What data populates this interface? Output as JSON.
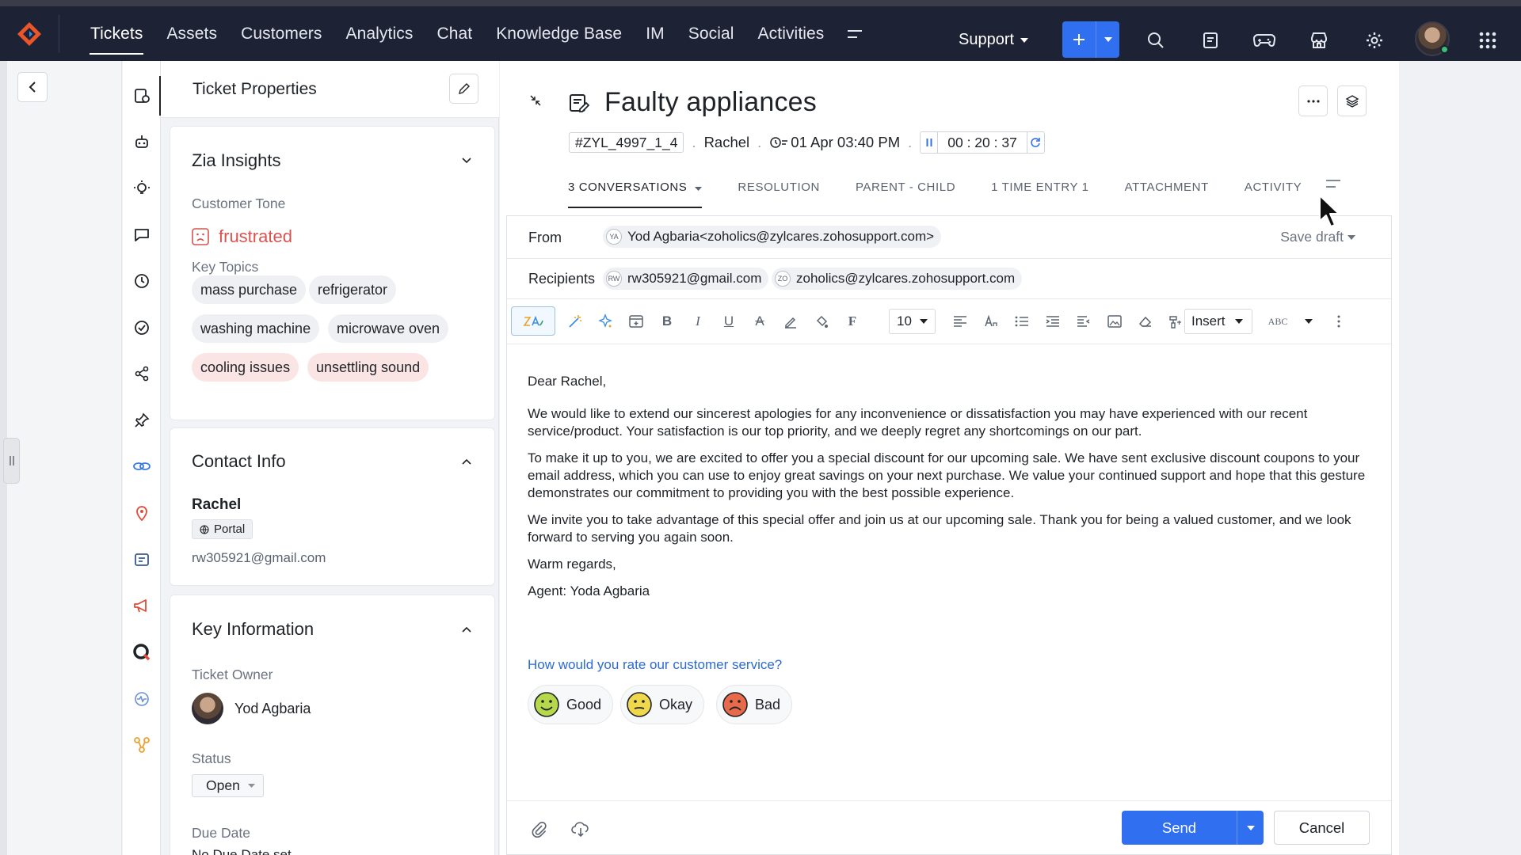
{
  "nav": {
    "tabs": [
      "Tickets",
      "Assets",
      "Customers",
      "Analytics",
      "Chat",
      "Knowledge Base",
      "IM",
      "Social",
      "Activities"
    ],
    "active_tab": "Tickets",
    "department": "Support"
  },
  "props": {
    "title": "Ticket Properties",
    "zia": {
      "title": "Zia Insights",
      "tone_label": "Customer Tone",
      "tone_value": "frustrated",
      "topics_label": "Key Topics",
      "topics": [
        "mass purchase",
        "refrigerator",
        "washing machine",
        "microwave oven",
        "cooling issues",
        "unsettling sound"
      ]
    },
    "contact": {
      "title": "Contact Info",
      "name": "Rachel",
      "channel": "Portal",
      "email": "rw305921@gmail.com"
    },
    "key_info": {
      "title": "Key Information",
      "owner_label": "Ticket Owner",
      "owner": "Yod Agbaria",
      "status_label": "Status",
      "status": "Open",
      "due_label": "Due Date",
      "due_value": "No Due Date set"
    }
  },
  "ticket": {
    "title": "Faulty appliances",
    "id": "#ZYL_4997_1_4",
    "contact": "Rachel",
    "datetime": "01 Apr 03:40 PM",
    "timer": "00 : 20 : 37",
    "tabs": [
      "3 CONVERSATIONS",
      "RESOLUTION",
      "PARENT - CHILD",
      "1 TIME ENTRY 1",
      "ATTACHMENT",
      "ACTIVITY"
    ]
  },
  "compose": {
    "from_label": "From",
    "from_initials": "YA",
    "from_value": "Yod Agbaria<zoholics@zylcares.zohosupport.com>",
    "save_draft": "Save draft",
    "recipients_label": "Recipients",
    "recipients": [
      {
        "initials": "RW",
        "email": "rw305921@gmail.com"
      },
      {
        "initials": "ZO",
        "email": "zoholics@zylcares.zohosupport.com"
      }
    ],
    "font_size": "10",
    "insert_label": "Insert",
    "spell_label": "ABC",
    "greeting": "Dear Rachel,",
    "paragraphs": [
      "We would like to extend our sincerest apologies for any inconvenience or dissatisfaction you may have experienced with our recent service/product. Your satisfaction is our top priority, and we deeply regret any shortcomings on our part.",
      "To make it up to you, we are excited to offer you a special discount for our upcoming sale. We have sent exclusive discount coupons to your email address, which you can use to enjoy great savings on your next purchase. We value your continued support and hope that this gesture demonstrates our commitment to providing you with the best possible experience.",
      "We invite you to take advantage of this special offer and join us at our upcoming sale. Thank you for being a valued customer, and we look forward to serving you again soon."
    ],
    "signoff": "Warm regards,",
    "agent": "Agent: Yoda Agbaria",
    "rating_question": "How would you rate our customer service?",
    "ratings": [
      "Good",
      "Okay",
      "Bad"
    ],
    "send_label": "Send",
    "cancel_label": "Cancel"
  },
  "colors": {
    "nav_bg": "#1e2235",
    "primary": "#2f6ff0",
    "tone_red": "#d9534f",
    "link_blue": "#2b6bd6"
  }
}
